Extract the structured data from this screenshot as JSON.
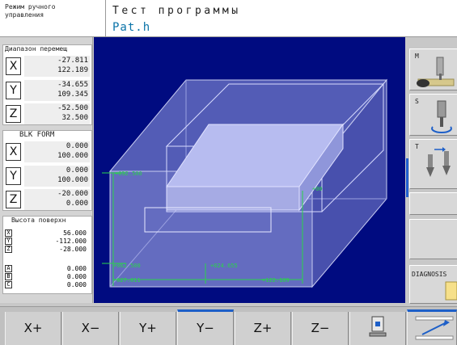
{
  "header": {
    "mode_line1": "Режим ручного",
    "mode_line2": "управления",
    "title": "Тест программы",
    "program": "Pat.h"
  },
  "left": {
    "range_title": "Диапазон перемещ",
    "range": [
      {
        "axis": "X",
        "min": "-27.811",
        "max": "122.189"
      },
      {
        "axis": "Y",
        "min": "-34.655",
        "max": "109.345"
      },
      {
        "axis": "Z",
        "min": "-52.500",
        "max": "32.500"
      }
    ],
    "blk_title": "BLK FORM",
    "blk": [
      {
        "axis": "X",
        "min": "0.000",
        "max": "100.000"
      },
      {
        "axis": "Y",
        "min": "0.000",
        "max": "100.000"
      },
      {
        "axis": "Z",
        "min": "-20.000",
        "max": "0.000"
      }
    ],
    "surface_title": "Высота поверхн",
    "surface": [
      {
        "axis": "X",
        "value": "56.000"
      },
      {
        "axis": "Y",
        "value": "-112.000"
      },
      {
        "axis": "Z",
        "value": "-28.000"
      }
    ],
    "rot": [
      {
        "axis": "A",
        "value": "0.000"
      },
      {
        "axis": "B",
        "value": "0.000"
      },
      {
        "axis": "C",
        "value": "0.000"
      }
    ]
  },
  "viewport": {
    "dims": {
      "y_top": "+032.500",
      "y_bottom": "+062.500",
      "mid": "+024.655",
      "x_left": "-027.811",
      "x_right": "+122.189",
      "small": "+00"
    }
  },
  "right": {
    "m_label": "M",
    "s_label": "S",
    "t_label": "T",
    "diag_label": "DIAGNOSIS"
  },
  "softkeys": [
    "X+",
    "X−",
    "Y+",
    "Y−",
    "Z+",
    "Z−"
  ],
  "colors": {
    "viewport_bg": "#000b80",
    "accent": "#1d5fc8",
    "dim_green": "#2ad44a"
  }
}
